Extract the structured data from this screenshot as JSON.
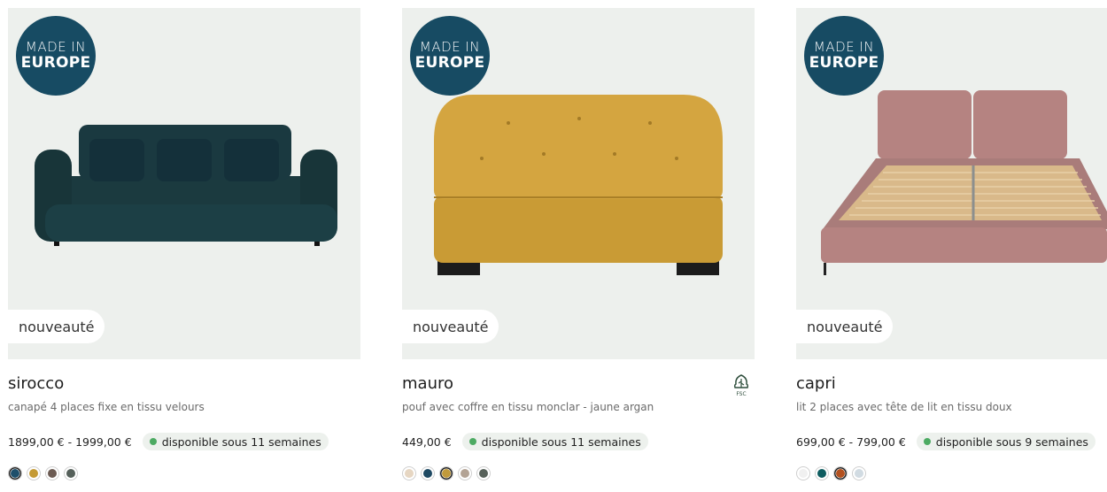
{
  "products": [
    {
      "badge_line1": "MADE IN",
      "badge_line2": "EUROPE",
      "new_label": "nouveauté",
      "title": "sirocco",
      "description": "canapé 4 places fixe en tissu velours",
      "price": "1899,00 € - 1999,00 €",
      "availability": "disponible sous 11 semaines",
      "swatches": [
        "#1e4f6b",
        "#c49a35",
        "#6b5a52",
        "#55605a"
      ],
      "selected_swatch": 0
    },
    {
      "badge_line1": "MADE IN",
      "badge_line2": "EUROPE",
      "new_label": "nouveauté",
      "title": "mauro",
      "description": "pouf avec coffre en tissu monclar - jaune argan",
      "price": "449,00 €",
      "availability": "disponible sous 11 semaines",
      "swatches": [
        "#e6d6c2",
        "#1f4a63",
        "#c19a3c",
        "#b3a395",
        "#566059"
      ],
      "selected_swatch": 2,
      "fsc_label": "FSC"
    },
    {
      "badge_line1": "MADE IN",
      "badge_line2": "EUROPE",
      "new_label": "nouveauté",
      "title": "capri",
      "description": "lit 2 places avec tête de lit en tissu doux",
      "price": "699,00 € - 799,00 €",
      "availability": "disponible sous 9 semaines",
      "swatches": [
        "#f0f0f0",
        "#0f5d60",
        "#b3511f",
        "#d1dbe2"
      ],
      "selected_swatch": 2
    }
  ],
  "colors": {
    "badge_bg": "#174b63",
    "image_bg": "#edf0ed",
    "availability_dot": "#4caa62"
  }
}
